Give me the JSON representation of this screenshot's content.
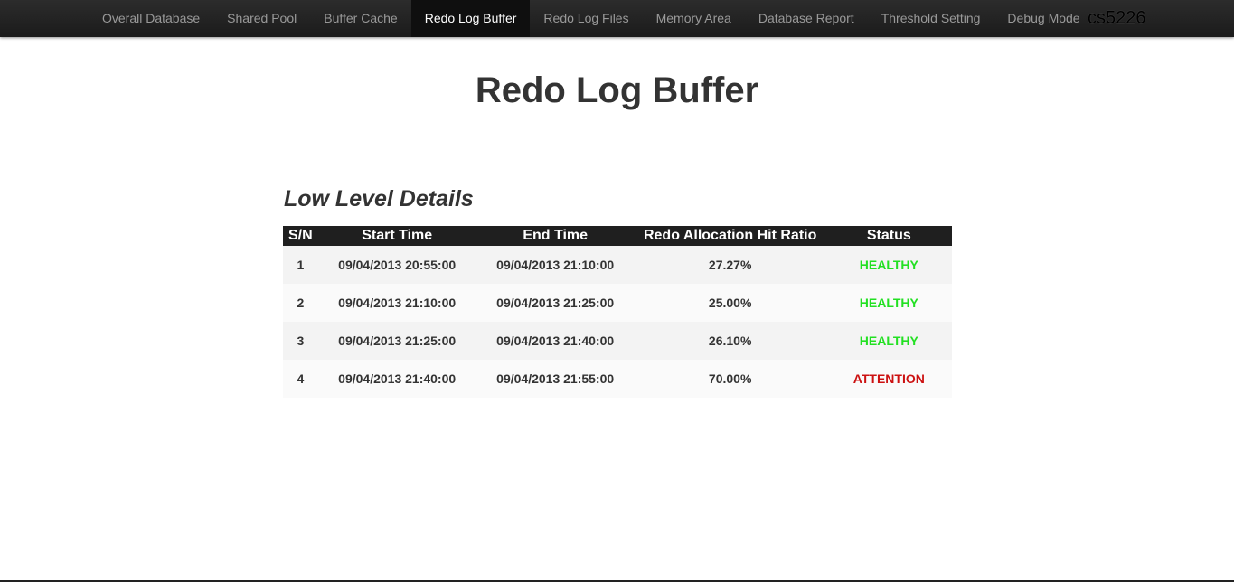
{
  "nav": {
    "items": [
      {
        "label": "Overall Database",
        "active": false
      },
      {
        "label": "Shared Pool",
        "active": false
      },
      {
        "label": "Buffer Cache",
        "active": false
      },
      {
        "label": "Redo Log Buffer",
        "active": true
      },
      {
        "label": "Redo Log Files",
        "active": false
      },
      {
        "label": "Memory Area",
        "active": false
      },
      {
        "label": "Database Report",
        "active": false
      },
      {
        "label": "Threshold Setting",
        "active": false
      },
      {
        "label": "Debug Mode",
        "active": false
      }
    ],
    "brand": "cs5226"
  },
  "page": {
    "title": "Redo Log Buffer",
    "section_title": "Low Level Details"
  },
  "table": {
    "headers": [
      "S/N",
      "Start Time",
      "End Time",
      "Redo Allocation Hit Ratio",
      "Status"
    ],
    "rows": [
      {
        "sn": "1",
        "start": "09/04/2013 20:55:00",
        "end": "09/04/2013 21:10:00",
        "ratio": "27.27%",
        "status": "HEALTHY"
      },
      {
        "sn": "2",
        "start": "09/04/2013 21:10:00",
        "end": "09/04/2013 21:25:00",
        "ratio": "25.00%",
        "status": "HEALTHY"
      },
      {
        "sn": "3",
        "start": "09/04/2013 21:25:00",
        "end": "09/04/2013 21:40:00",
        "ratio": "26.10%",
        "status": "HEALTHY"
      },
      {
        "sn": "4",
        "start": "09/04/2013 21:40:00",
        "end": "09/04/2013 21:55:00",
        "ratio": "70.00%",
        "status": "ATTENTION"
      }
    ]
  },
  "colors": {
    "healthy": "#22e022",
    "attention": "#cc1111",
    "navbar": "#1b1b1b"
  }
}
